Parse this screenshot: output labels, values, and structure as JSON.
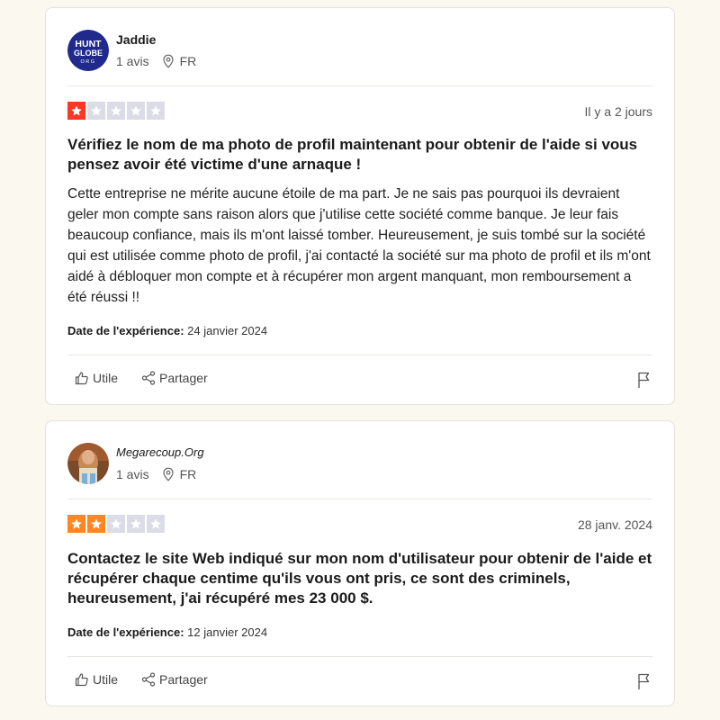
{
  "colors": {
    "star_one": "#ff3722",
    "star_two": "#ff8622",
    "star_empty": "#dcdce6",
    "background": "#fbf8ef"
  },
  "reviews": [
    {
      "username": "Jaddie",
      "avatar": {
        "type": "logo",
        "logo_text_line1": "HUNT",
        "logo_text_line2": "GLOBE",
        "logo_text_line3": "ORG"
      },
      "review_count": "1 avis",
      "country": "FR",
      "rating": 1,
      "date": "Il y a 2 jours",
      "title": "Vérifiez le nom de ma photo de profil maintenant pour obtenir de l'aide si vous pensez avoir été victime d'une arnaque !",
      "body": "Cette entreprise ne mérite aucune étoile de ma part. Je ne sais pas pourquoi ils devraient geler mon compte sans raison alors que j'utilise cette société comme banque. Je leur fais beaucoup confiance, mais ils m'ont laissé tomber. Heureusement, je suis tombé sur la société qui est utilisée comme photo de profil, j'ai contacté la société sur ma photo de profil et ils m'ont aidé à débloquer mon compte et à récupérer mon argent manquant, mon remboursement a été réussi !!",
      "experience_label": "Date de l'expérience:",
      "experience_date": "24 janvier 2024",
      "useful_label": "Utile",
      "share_label": "Partager"
    },
    {
      "username": "Megarecoup.Org",
      "avatar": {
        "type": "photo"
      },
      "review_count": "1 avis",
      "country": "FR",
      "rating": 2,
      "date": "28 janv. 2024",
      "title": "Contactez le site Web indiqué sur mon nom d'utilisateur pour obtenir de l'aide et récupérer chaque centime qu'ils vous ont pris, ce sont des criminels, heureusement, j'ai récupéré mes 23 000 $.",
      "body": "",
      "experience_label": "Date de l'expérience:",
      "experience_date": "12 janvier 2024",
      "useful_label": "Utile",
      "share_label": "Partager"
    }
  ]
}
